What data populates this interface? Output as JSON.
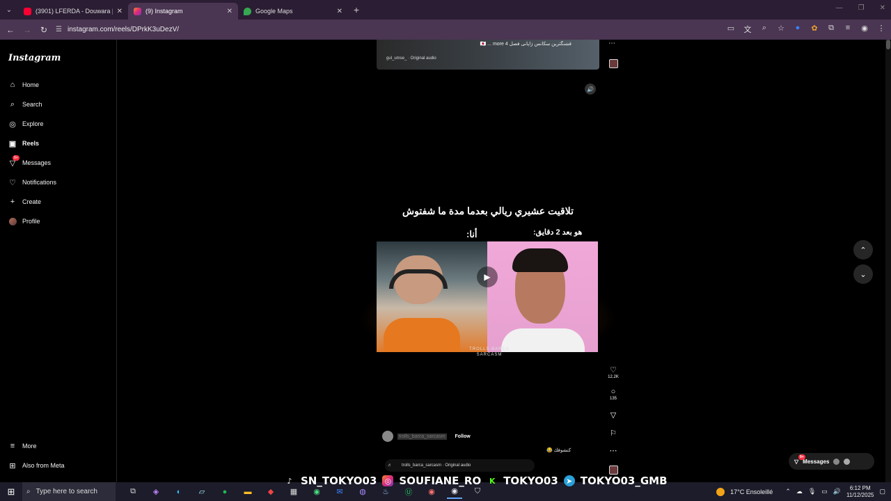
{
  "browser": {
    "tabs": [
      {
        "title": "(3901) LFERDA - Douwara [Clip",
        "favicon_color": "#ff0033",
        "active": false
      },
      {
        "title": "(9) Instagram",
        "favicon_color": "#e1306c",
        "active": true
      },
      {
        "title": "Google Maps",
        "favicon_color": "#34a853",
        "active": false
      }
    ],
    "url": "instagram.com/reels/DPrkK3uDezV/"
  },
  "sidebar": {
    "logo": "Instagram",
    "items": [
      {
        "label": "Home",
        "icon": "home-icon"
      },
      {
        "label": "Search",
        "icon": "search-icon"
      },
      {
        "label": "Explore",
        "icon": "compass-icon"
      },
      {
        "label": "Reels",
        "icon": "reels-icon"
      },
      {
        "label": "Messages",
        "icon": "messenger-icon",
        "badge": "9+"
      },
      {
        "label": "Notifications",
        "icon": "heart-icon"
      },
      {
        "label": "Create",
        "icon": "plus-icon"
      },
      {
        "label": "Profile",
        "icon": "avatar"
      }
    ],
    "more": "More",
    "also_from_meta": "Also from Meta"
  },
  "prev_reel": {
    "caption": "قشنگترین سکانس ژاپانی فصل 4 🇯🇵 ... more",
    "audio": "gul_umse_ · Original audio"
  },
  "reel": {
    "title_ar": "تلاقيت عشيري ريالي بعدما مدة ما شفتوش",
    "label_him": "هو بعد 2 دقايق:",
    "label_me": "أنا:",
    "watermark": "TROLLS BARCA SARCASM",
    "username": "trolls_barca_sarcasm",
    "follow": "Follow",
    "caption": "كنشوفك 😂",
    "audio": "trolls_barca_sarcasm · Original audio",
    "likes": "12.2K",
    "comments": "135"
  },
  "messages_pill": {
    "label": "Messages",
    "badge": "9+"
  },
  "overlay": {
    "tiktok": "SN_TOKYO03",
    "instagram": "SOUFIANE_RO",
    "kick": "TOKYO03",
    "telegram": "TOKYO03_GMB"
  },
  "taskbar": {
    "search_placeholder": "Type here to search",
    "weather": "17°C  Ensoleillé",
    "time": "6:12 PM",
    "date": "11/12/2025"
  }
}
